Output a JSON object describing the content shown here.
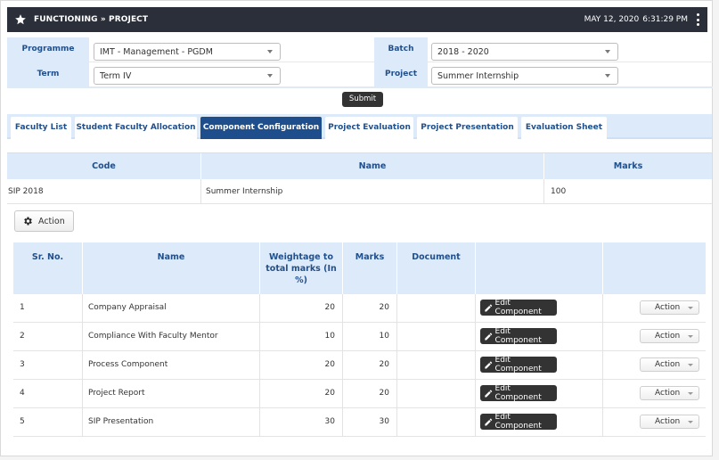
{
  "header": {
    "title": "FUNCTIONING » PROJECT",
    "date": "MAY 12, 2020",
    "time": "6:31:29 PM"
  },
  "filters": {
    "programme_label": "Programme",
    "programme_value": "IMT - Management - PGDM",
    "batch_label": "Batch",
    "batch_value": "2018 - 2020",
    "term_label": "Term",
    "term_value": "Term IV",
    "project_label": "Project",
    "project_value": "Summer Internship",
    "submit_label": "Submit"
  },
  "tabs": [
    {
      "label": "Faculty List"
    },
    {
      "label": "Student Faculty Allocation"
    },
    {
      "label": "Component Configuration"
    },
    {
      "label": "Project Evaluation"
    },
    {
      "label": "Project Presentation"
    },
    {
      "label": "Evaluation Sheet"
    }
  ],
  "code_table": {
    "headers": {
      "code": "Code",
      "name": "Name",
      "marks": "Marks"
    },
    "row": {
      "code": "SIP 2018",
      "name": "Summer Internship",
      "marks": "100"
    }
  },
  "action_label": "Action",
  "component_table": {
    "headers": {
      "sr": "Sr. No.",
      "name": "Name",
      "weightage_1": "Weightage to",
      "weightage_2": "total marks (In",
      "weightage_3": "%)",
      "marks": "Marks",
      "document": "Document"
    },
    "edit_label": "Edit Component",
    "row_action_label": "Action",
    "rows": [
      {
        "sr": "1",
        "name": "Company Appraisal",
        "weightage": "20",
        "marks": "20"
      },
      {
        "sr": "2",
        "name": "Compliance With Faculty Mentor",
        "weightage": "10",
        "marks": "10"
      },
      {
        "sr": "3",
        "name": "Process Component",
        "weightage": "20",
        "marks": "20"
      },
      {
        "sr": "4",
        "name": "Project Report",
        "weightage": "20",
        "marks": "20"
      },
      {
        "sr": "5",
        "name": "SIP Presentation",
        "weightage": "30",
        "marks": "30"
      }
    ]
  },
  "colors": {
    "header_bg": "#2b2f3a",
    "label_bg": "#ddeafa",
    "label_text": "#22508b",
    "active_tab_bg": "#1e4f8c",
    "button_dark": "#333333"
  },
  "icons": {
    "header": "star-icon",
    "menu": "kebab-menu-icon",
    "action": "gear-icon",
    "edit": "pencil-icon"
  }
}
